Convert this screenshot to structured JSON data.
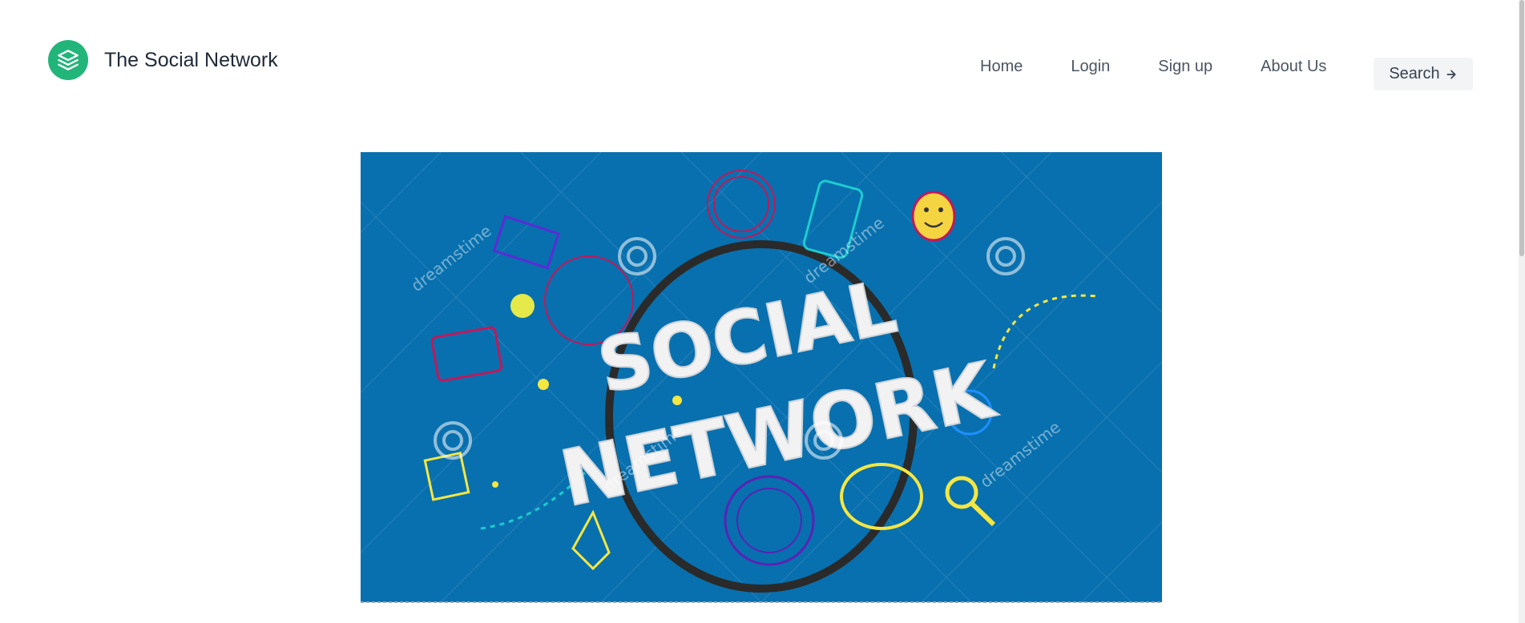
{
  "brand": {
    "name": "The Social Network",
    "logo_icon": "layers-icon",
    "accent": "#22b57a"
  },
  "nav": {
    "items": [
      {
        "label": "Home"
      },
      {
        "label": "Login"
      },
      {
        "label": "Sign up"
      },
      {
        "label": "About Us"
      }
    ],
    "search_label": "Search",
    "search_icon": "arrow-right-icon"
  },
  "hero": {
    "title_line1": "SOCIAL",
    "title_line2": "NETWORK",
    "watermark": "dreamstime",
    "background": "#0870ae"
  }
}
